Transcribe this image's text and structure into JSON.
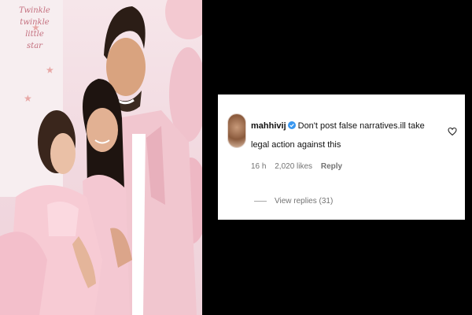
{
  "photo": {
    "banner_lines": [
      "Twinkle",
      "twinkle",
      "little",
      "star"
    ]
  },
  "comment": {
    "username": "mahhivij",
    "text": "Don't post false narratives.ill take legal action against this",
    "time": "16 h",
    "likes": "2,020 likes",
    "reply_label": "Reply",
    "view_replies": "View replies (31)",
    "verified_color": "#3897f0"
  },
  "icons": {
    "verified": "verified-badge-icon",
    "like": "heart-outline-icon"
  }
}
